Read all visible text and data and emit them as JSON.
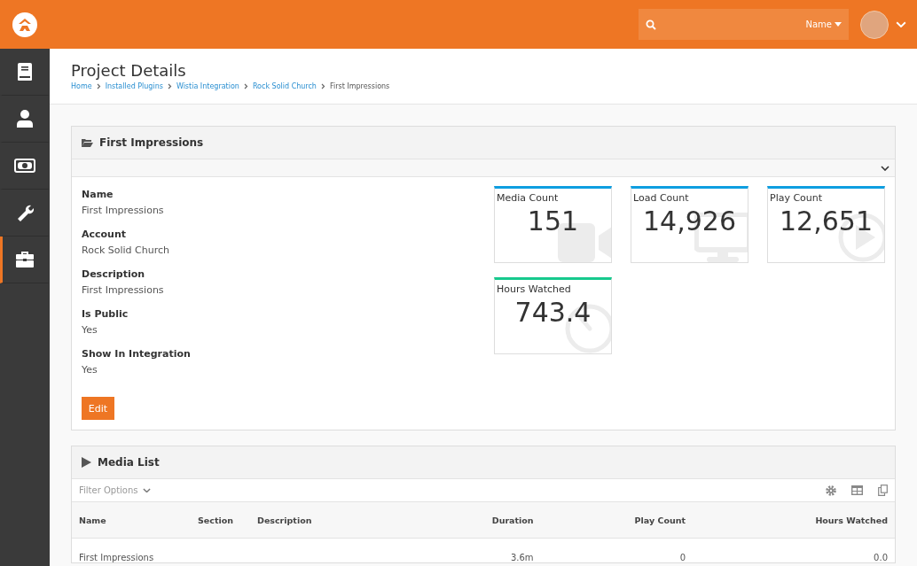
{
  "header": {
    "search": {
      "filter_label": "Name"
    }
  },
  "sidebar": {
    "items": [
      {
        "selected": false
      },
      {
        "selected": false
      },
      {
        "selected": false
      },
      {
        "selected": false
      },
      {
        "selected": true
      }
    ]
  },
  "page": {
    "title": "Project Details",
    "breadcrumbs": [
      "Home",
      "Installed Plugins",
      "Wistia Integration",
      "Rock Solid Church",
      "First Impressions"
    ]
  },
  "detail_panel": {
    "title": "First Impressions",
    "fields": [
      {
        "label": "Name",
        "value": "First Impressions"
      },
      {
        "label": "Account",
        "value": "Rock Solid Church"
      },
      {
        "label": "Description",
        "value": "First Impressions"
      },
      {
        "label": "Is Public",
        "value": "Yes"
      },
      {
        "label": "Show In Integration",
        "value": "Yes"
      }
    ],
    "edit_button": "Edit",
    "stats": [
      {
        "label": "Media Count",
        "value": "151",
        "color": "#0e9ee0"
      },
      {
        "label": "Load Count",
        "value": "14,926",
        "color": "#0e9ee0"
      },
      {
        "label": "Play Count",
        "value": "12,651",
        "color": "#0e9ee0"
      },
      {
        "label": "Hours Watched",
        "value": "743.4",
        "color": "#16c98d"
      }
    ]
  },
  "media_list": {
    "title": "Media List",
    "filter_label": "Filter Options",
    "columns": [
      "Name",
      "Section",
      "Description",
      "Duration",
      "Play Count",
      "Hours Watched"
    ],
    "rows": [
      [
        "First Impressions",
        "",
        "",
        "3.6m",
        "0",
        "0.0"
      ]
    ]
  }
}
